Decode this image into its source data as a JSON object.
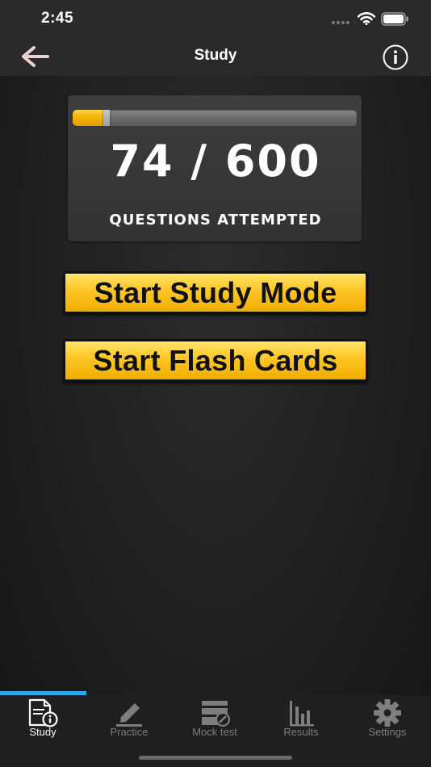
{
  "status_bar": {
    "time": "2:45"
  },
  "nav": {
    "title": "Study",
    "back_icon": "back-arrow-icon",
    "info_icon": "info-icon"
  },
  "progress": {
    "attempted": 74,
    "total": 600,
    "count_text": "74 / 600",
    "label": "QUESTIONS ATTEMPTED",
    "fill_fraction": 0.12
  },
  "actions": {
    "study_mode_label": "Start Study Mode",
    "flash_cards_label": "Start Flash Cards"
  },
  "tabs": [
    {
      "label": "Study",
      "icon": "study-document-icon",
      "active": true
    },
    {
      "label": "Practice",
      "icon": "pencil-icon",
      "active": false
    },
    {
      "label": "Mock test",
      "icon": "mock-test-icon",
      "active": false
    },
    {
      "label": "Results",
      "icon": "bar-chart-icon",
      "active": false
    },
    {
      "label": "Settings",
      "icon": "gear-icon",
      "active": false
    }
  ],
  "colors": {
    "accent_yellow": "#f5b400",
    "tab_indicator": "#2ea8e6",
    "background": "#1a1a1a"
  }
}
